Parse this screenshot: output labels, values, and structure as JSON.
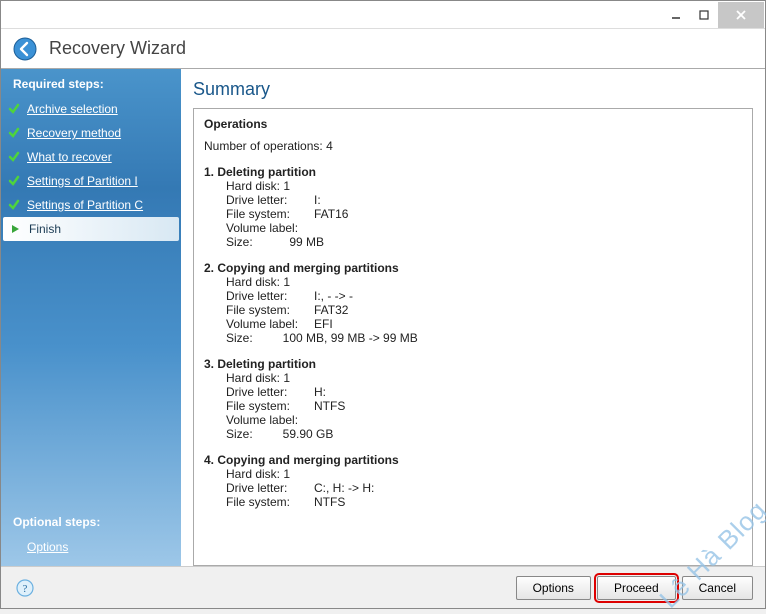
{
  "window": {
    "title": "Recovery Wizard"
  },
  "sidebar": {
    "required_label": "Required steps:",
    "items": [
      {
        "label": "Archive selection",
        "done": true
      },
      {
        "label": "Recovery method",
        "done": true
      },
      {
        "label": "What to recover",
        "done": true
      },
      {
        "label": "Settings of Partition I",
        "done": true
      },
      {
        "label": "Settings of Partition C",
        "done": true
      },
      {
        "label": "Finish",
        "done": false,
        "active": true
      }
    ],
    "optional_label": "Optional steps:",
    "options_label": "Options"
  },
  "content": {
    "title": "Summary",
    "ops_heading": "Operations",
    "ops_count_label": "Number of operations: 4",
    "operations": [
      {
        "title": "1. Deleting partition",
        "hard_disk": "Hard disk:  1",
        "drive_letter_k": "Drive letter:",
        "drive_letter_v": "I:",
        "file_system_k": "File system:",
        "file_system_v": "FAT16",
        "volume_label_k": "Volume label:",
        "volume_label_v": "",
        "size_label": "Size:           99 MB"
      },
      {
        "title": "2. Copying and merging partitions",
        "hard_disk": "Hard disk:  1",
        "drive_letter_k": "Drive letter:",
        "drive_letter_v": "I:, - -> -",
        "file_system_k": "File system:",
        "file_system_v": "FAT32",
        "volume_label_k": "Volume label:",
        "volume_label_v": "EFI",
        "size_label": "Size:         100 MB, 99 MB -> 99 MB"
      },
      {
        "title": "3. Deleting partition",
        "hard_disk": "Hard disk:  1",
        "drive_letter_k": "Drive letter:",
        "drive_letter_v": "H:",
        "file_system_k": "File system:",
        "file_system_v": "NTFS",
        "volume_label_k": "Volume label:",
        "volume_label_v": "",
        "size_label": "Size:         59.90 GB"
      },
      {
        "title": "4. Copying and merging partitions",
        "hard_disk": "Hard disk:  1",
        "drive_letter_k": "Drive letter:",
        "drive_letter_v": "C:, H: -> H:",
        "file_system_k": "File system:",
        "file_system_v": "NTFS",
        "volume_label_k": "",
        "volume_label_v": "",
        "size_label": ""
      }
    ]
  },
  "footer": {
    "options_label": "Options",
    "proceed_label": "Proceed",
    "cancel_label": "Cancel"
  },
  "watermark": "Lê Hà Blog"
}
